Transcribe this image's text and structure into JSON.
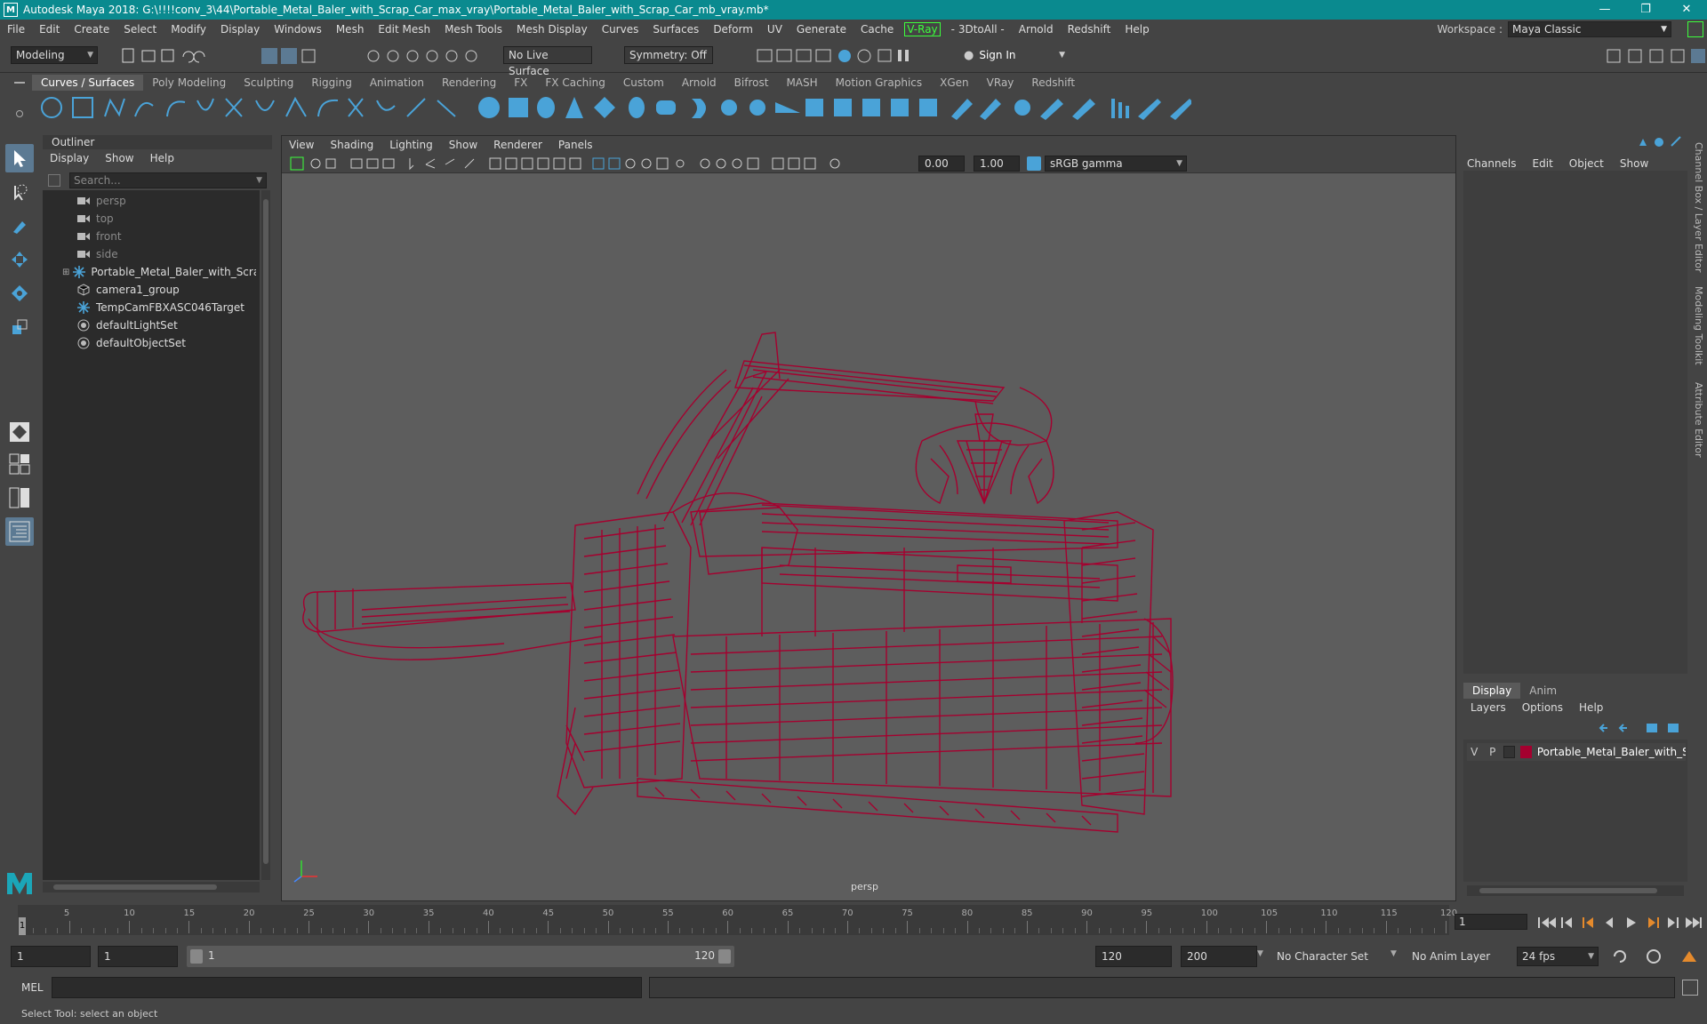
{
  "title_bar": {
    "text": "Autodesk Maya 2018: G:\\!!!!conv_3\\44\\Portable_Metal_Baler_with_Scrap_Car_max_vray\\Portable_Metal_Baler_with_Scrap_Car_mb_vray.mb*"
  },
  "menu": [
    "File",
    "Edit",
    "Create",
    "Select",
    "Modify",
    "Display",
    "Windows",
    "Mesh",
    "Edit Mesh",
    "Mesh Tools",
    "Mesh Display",
    "Curves",
    "Surfaces",
    "Deform",
    "UV",
    "Generate",
    "Cache"
  ],
  "menu_vray": "V-Ray",
  "menu_tail": [
    "- 3DtoAll -",
    "Arnold",
    "Redshift",
    "Help"
  ],
  "workspace": {
    "label": "Workspace :",
    "value": "Maya Classic"
  },
  "status": {
    "mode": "Modeling",
    "live_surface": "No Live Surface",
    "symmetry": "Symmetry: Off",
    "sign_in": "Sign In"
  },
  "shelf_tabs": [
    "Curves / Surfaces",
    "Poly Modeling",
    "Sculpting",
    "Rigging",
    "Animation",
    "Rendering",
    "FX",
    "FX Caching",
    "Custom",
    "Arnold",
    "Bifrost",
    "MASH",
    "Motion Graphics",
    "XGen",
    "VRay",
    "Redshift"
  ],
  "outliner": {
    "title": "Outliner",
    "menu": [
      "Display",
      "Show",
      "Help"
    ],
    "search_placeholder": "Search...",
    "items": [
      {
        "label": "persp",
        "icon": "camera-icon",
        "dim": true
      },
      {
        "label": "top",
        "icon": "camera-icon",
        "dim": true
      },
      {
        "label": "front",
        "icon": "camera-icon",
        "dim": true
      },
      {
        "label": "side",
        "icon": "camera-icon",
        "dim": true
      },
      {
        "label": "Portable_Metal_Baler_with_Scrap_Car",
        "icon": "transform-icon",
        "dim": false
      },
      {
        "label": "camera1_group",
        "icon": "group-icon",
        "dim": false
      },
      {
        "label": "TempCamFBXASC046Target",
        "icon": "transform-icon",
        "dim": false
      },
      {
        "label": "defaultLightSet",
        "icon": "set-icon",
        "dim": false
      },
      {
        "label": "defaultObjectSet",
        "icon": "set-icon",
        "dim": false
      }
    ]
  },
  "viewport": {
    "menu": [
      "View",
      "Shading",
      "Lighting",
      "Show",
      "Renderer",
      "Panels"
    ],
    "exposure": "0.00",
    "gamma": "1.00",
    "color_space": "sRGB gamma",
    "camera_label": "persp",
    "wire_color": "#a5002f"
  },
  "channel_box": {
    "menu": [
      "Channels",
      "Edit",
      "Object",
      "Show"
    ]
  },
  "layer_editor": {
    "tabs": [
      "Display",
      "Anim"
    ],
    "menu": [
      "Layers",
      "Options",
      "Help"
    ],
    "layer": {
      "v": "V",
      "p": "P",
      "name": "Portable_Metal_Baler_with_Scr",
      "color": "#a5002f"
    }
  },
  "side_tabs": [
    "Channel Box / Layer Editor",
    "Modeling Toolkit",
    "Attribute Editor"
  ],
  "timeline": {
    "labels": [
      "5",
      "10",
      "15",
      "20",
      "25",
      "30",
      "35",
      "40",
      "45",
      "50",
      "55",
      "60",
      "65",
      "70",
      "75",
      "80",
      "85",
      "90",
      "95",
      "100",
      "105",
      "110",
      "115",
      "120"
    ],
    "current_frame": "1",
    "playhead_marker": "1"
  },
  "range": {
    "start": "1",
    "start_inner": "1",
    "bar_start": "1",
    "bar_end": "120",
    "end_inner": "120",
    "end": "200",
    "character_set": "No Character Set",
    "anim_layer": "No Anim Layer",
    "fps": "24 fps"
  },
  "command": {
    "label": "MEL"
  },
  "help_line": "Select Tool: select an object"
}
